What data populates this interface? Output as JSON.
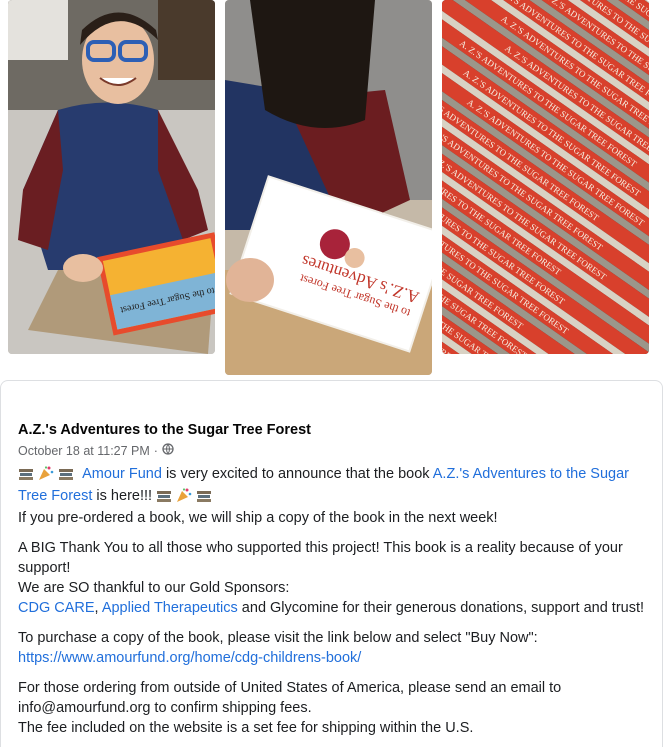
{
  "photos": [
    {
      "icon": "photo-boy-holding-book"
    },
    {
      "icon": "photo-boy-reading-book"
    },
    {
      "icon": "photo-stack-of-books",
      "spine_text": "A. Z.'S ADVENTURES TO THE SUGAR TREE FOREST"
    }
  ],
  "book_cover": {
    "title": "A.Z.'s Adventures",
    "subtitle": "to the Sugar Tree Forest"
  },
  "post": {
    "title": "A.Z.'s Adventures to the Sugar Tree Forest",
    "date": "October 18 at 11:27 PM",
    "dot": "·",
    "privacy_icon": "globe-icon",
    "intro_link1": "Amour Fund",
    "intro_text1": " is very excited to announce that the book ",
    "intro_link2": "A.Z.'s Adventures to the Sugar Tree Forest",
    "intro_text2": " is here!!!",
    "preorder": "If you pre-ordered a book, we will ship a copy of the book in the next week!",
    "thanks": "A BIG Thank You to all those who supported this project! This book is a reality because of your support!",
    "gold": "We are SO thankful to our Gold Sponsors:",
    "sponsor1": "CDG CARE",
    "sponsor_sep": ", ",
    "sponsor2": "Applied Therapeutics",
    "sponsor_rest": " and Glycomine for their generous donations, support and trust!",
    "purchase": "To purchase a copy of the book, please visit the link below and select \"Buy Now\":",
    "url": "https://www.amourfund.org/home/cdg-childrens-book/",
    "outside": "For those ordering from outside of United States of America, please send an email to info@amourfund.org to confirm shipping fees.",
    "fee": "The fee included on the website is a set fee for shipping within the U.S."
  },
  "colors": {
    "link": "#216fdb",
    "spine_red": "#d8402c",
    "meta": "#65676b"
  }
}
